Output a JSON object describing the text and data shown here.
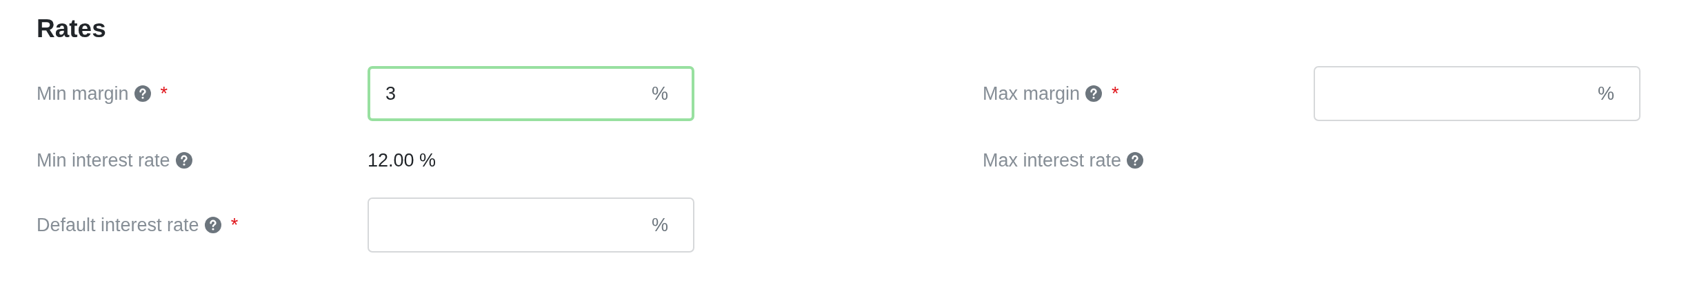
{
  "title": "Rates",
  "rows": [
    [
      {
        "kind": "input",
        "label": "Min margin",
        "help": true,
        "required_mark": "*",
        "value": "3",
        "unit": "%",
        "focused": true
      },
      {
        "kind": "input",
        "label": "Max margin",
        "help": true,
        "required_mark": "*",
        "unit": "%",
        "focused": false
      }
    ],
    [
      {
        "kind": "readout",
        "label": "Min interest rate",
        "help": true,
        "value": "12.00 %"
      },
      {
        "kind": "readout",
        "label": "Max interest rate",
        "help": true
      }
    ],
    [
      {
        "kind": "input",
        "label": "Default interest rate",
        "help": true,
        "required_mark": "*",
        "unit": "%",
        "focused": false
      }
    ]
  ]
}
